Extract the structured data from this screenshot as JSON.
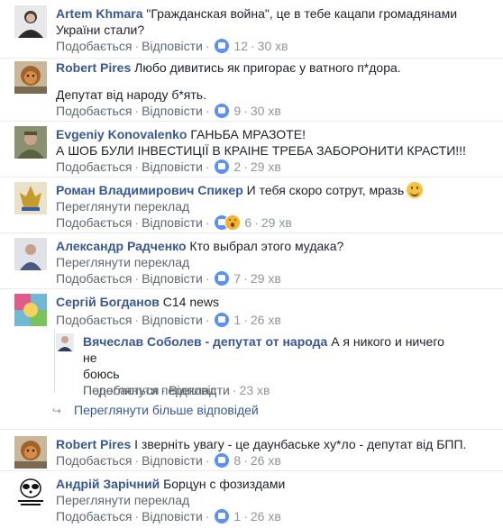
{
  "comments": [
    {
      "author": "Artem Khmara",
      "text_lines": [
        "\"Гражданская война\", це в тебе кацапи громадянами",
        "України стали?"
      ],
      "like_label": "Подобається",
      "reply_label": "Відповісти",
      "reactions": "12",
      "time": "30 хв"
    },
    {
      "author": "Robert Pires",
      "text_lines": [
        "Любо дивитись як пригорає у ватного п*дора.",
        "",
        "Депутат від народу б*ять."
      ],
      "like_label": "Подобається",
      "reply_label": "Відповісти",
      "reactions": "9",
      "time": "30 хв"
    },
    {
      "author": "Evgeniy Konovalenko",
      "text_lines": [
        "ГАНЬБА МРАЗОТЕ!",
        "А ШОБ БУЛИ ІНВЕСТИЦІЇ В КРАІНЕ ТРЕБА ЗАБОРОНИТИ КРАСТИ!!!"
      ],
      "like_label": "Подобається",
      "reply_label": "Відповісти",
      "reactions": "2",
      "time": "29 хв"
    },
    {
      "author": "Роман Владимирович Спикер",
      "text_lines": [
        "И тебя скоро сотрут, мразь"
      ],
      "translate": "Переглянути переклад",
      "like_label": "Подобається",
      "reply_label": "Відповісти",
      "reactions": "6",
      "time": "29 хв"
    },
    {
      "author": "Александр Радченко",
      "text_lines": [
        "Кто выбрал этого мудака?"
      ],
      "translate": "Переглянути переклад",
      "like_label": "Подобається",
      "reply_label": "Відповісти",
      "reactions": "7",
      "time": "29 хв"
    },
    {
      "author": "Сергій Богданов",
      "text_lines": [
        "C14 news"
      ],
      "like_label": "Подобається",
      "reply_label": "Відповісти",
      "reactions": "1",
      "time": "26 хв"
    },
    {
      "author": "Вячеслав Соболев - депутат от народа",
      "text_lines": [
        "А я никого и ничего не",
        "боюсь"
      ],
      "translate": "Переглянути переклад",
      "like_label": "Подобається",
      "reply_label": "Відповісти",
      "time": "23 хв"
    },
    {
      "author": "Robert Pires",
      "text_lines": [
        "І зверніть увагу - це даунбаське ху*ло - депутат від БПП."
      ],
      "like_label": "Подобається",
      "reply_label": "Відповісти",
      "reactions": "8",
      "time": "26 хв"
    },
    {
      "author": "Андрій Зарічний",
      "text_lines": [
        "Борцун с фозиздами"
      ],
      "translate": "Переглянути переклад",
      "like_label": "Подобається",
      "reply_label": "Відповісти",
      "reactions": "1",
      "time": "26 хв"
    }
  ],
  "more_replies_label": "Переглянути більше відповідей",
  "colors": {
    "author": "#365899",
    "meta": "#616770",
    "like": "#5890ff",
    "wow": "#f7b125",
    "separator": "#e9ebee"
  },
  "icons": [
    "like-reaction-icon",
    "wow-reaction-icon",
    "smile-emoji-icon",
    "reply-arrow-icon"
  ]
}
